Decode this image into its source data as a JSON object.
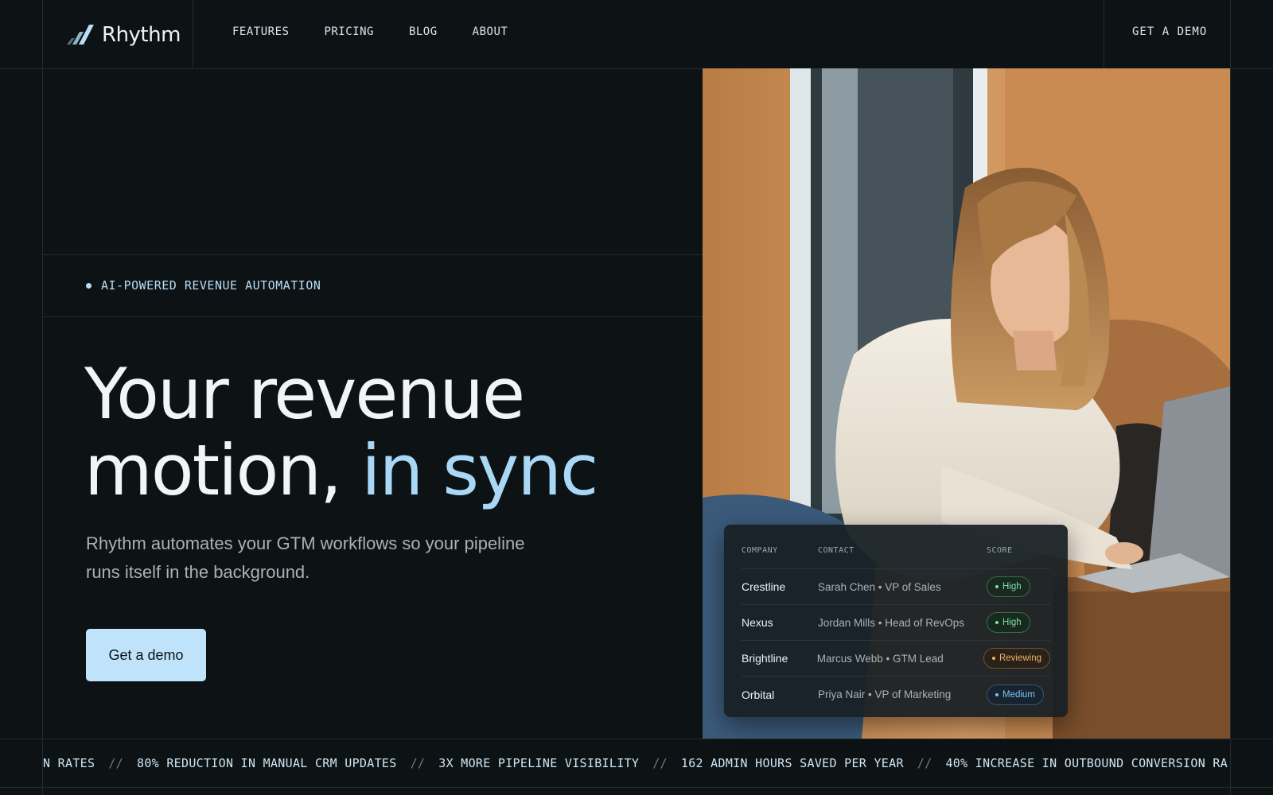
{
  "brand": {
    "name": "Rhythm"
  },
  "nav": {
    "items": [
      {
        "label": "FEATURES"
      },
      {
        "label": "PRICING"
      },
      {
        "label": "BLOG"
      },
      {
        "label": "ABOUT"
      }
    ],
    "cta_label": "GET A DEMO"
  },
  "hero": {
    "eyebrow": "AI-POWERED REVENUE AUTOMATION",
    "headline_line1": "Your revenue",
    "headline_line2_plain": "motion,",
    "headline_line2_accent": "in sync",
    "subhead": "Rhythm automates your GTM workflows so your pipeline runs itself in the background.",
    "cta_label": "Get a demo"
  },
  "lead_card": {
    "columns": {
      "company": "COMPANY",
      "contact": "CONTACT",
      "score": "SCORE"
    },
    "rows": [
      {
        "company": "Crestline",
        "contact": "Sarah Chen • VP of Sales",
        "score": "High"
      },
      {
        "company": "Nexus",
        "contact": "Jordan Mills • Head of RevOps",
        "score": "High"
      },
      {
        "company": "Brightline",
        "contact": "Marcus Webb • GTM Lead",
        "score": "Reviewing"
      },
      {
        "company": "Orbital",
        "contact": "Priya Nair • VP of Marketing",
        "score": "Medium"
      }
    ]
  },
  "ticker": {
    "items": [
      "N RATES",
      "80% REDUCTION IN MANUAL CRM UPDATES",
      "3X MORE PIPELINE VISIBILITY",
      "162 ADMIN HOURS SAVED PER YEAR",
      "40% INCREASE IN OUTBOUND CONVERSION RA"
    ],
    "separator": "//"
  },
  "colors": {
    "background": "#0d1214",
    "accent": "#a9d7f6",
    "button": "#bfe3fa",
    "high": "#7fe0a0",
    "reviewing": "#f0b06a",
    "medium": "#7cc4f5"
  }
}
